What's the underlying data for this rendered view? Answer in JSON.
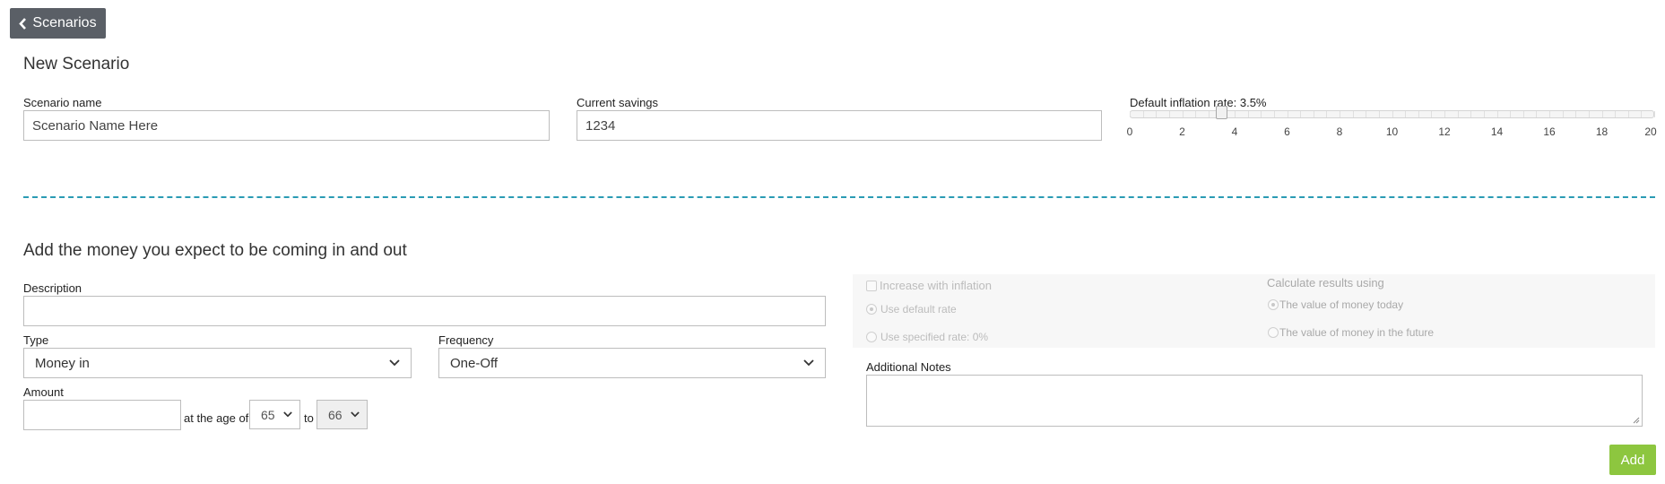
{
  "nav": {
    "back_label": "Scenarios"
  },
  "scenario": {
    "title": "New Scenario",
    "name_label": "Scenario name",
    "name_value": "Scenario Name Here",
    "savings_label": "Current savings",
    "savings_value": "1234",
    "inflation_label": "Default inflation rate: 3.5%",
    "inflation_value": 3.5,
    "inflation_min": 0,
    "inflation_max": 20,
    "inflation_ticks": [
      "0",
      "2",
      "4",
      "6",
      "8",
      "10",
      "12",
      "14",
      "16",
      "18",
      "20"
    ]
  },
  "money": {
    "title": "Add the money you expect to be coming in and out",
    "description_label": "Description",
    "description_value": "",
    "type_label": "Type",
    "type_value": "Money in",
    "frequency_label": "Frequency",
    "frequency_value": "One-Off",
    "amount_label": "Amount",
    "amount_value": "",
    "age_text": "at the age of",
    "age_from": "65",
    "to_text": "to",
    "age_to": "66",
    "inflation_checkbox_label": "Increase with inflation",
    "use_default_rate_label": "Use default rate",
    "use_specified_rate_label": "Use specified rate: 0%",
    "calculate_label": "Calculate results using",
    "value_today_label": "The value of money today",
    "value_future_label": "The value of money in the future",
    "notes_label": "Additional Notes",
    "add_label": "Add"
  },
  "colors": {
    "back_button": "#5a5f66",
    "add_button": "#8dc63f",
    "divider": "#2a9bb4"
  }
}
